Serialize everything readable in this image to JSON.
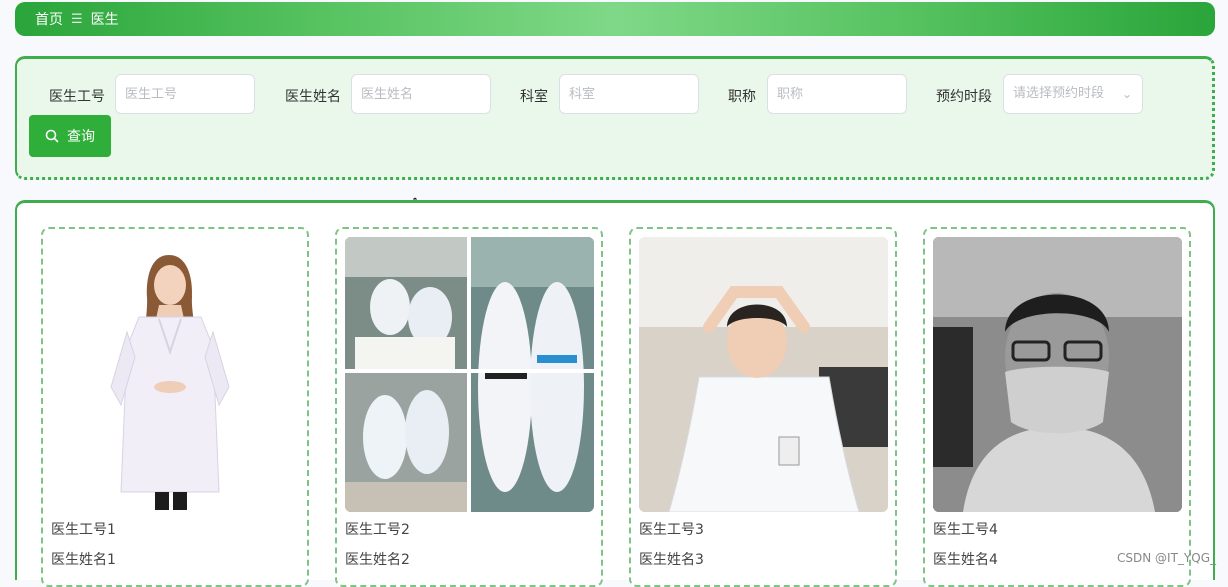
{
  "breadcrumb": {
    "home": "首页",
    "separator": "☰",
    "current": "医生"
  },
  "search": {
    "fields": [
      {
        "label": "医生工号",
        "placeholder": "医生工号"
      },
      {
        "label": "医生姓名",
        "placeholder": "医生姓名"
      },
      {
        "label": "科室",
        "placeholder": "科室"
      },
      {
        "label": "职称",
        "placeholder": "职称"
      }
    ],
    "period": {
      "label": "预约时段",
      "placeholder": "请选择预约时段"
    },
    "query_label": "查询"
  },
  "cards": [
    {
      "id": "医生工号1",
      "name": "医生姓名1"
    },
    {
      "id": "医生工号2",
      "name": "医生姓名2"
    },
    {
      "id": "医生工号3",
      "name": "医生姓名3"
    },
    {
      "id": "医生工号4",
      "name": "医生姓名4"
    }
  ],
  "watermark": "CSDN @IT_YQG_",
  "colors": {
    "accent": "#2fae3a",
    "panel_bg": "#eaf8ec",
    "border": "#3fad4c"
  }
}
